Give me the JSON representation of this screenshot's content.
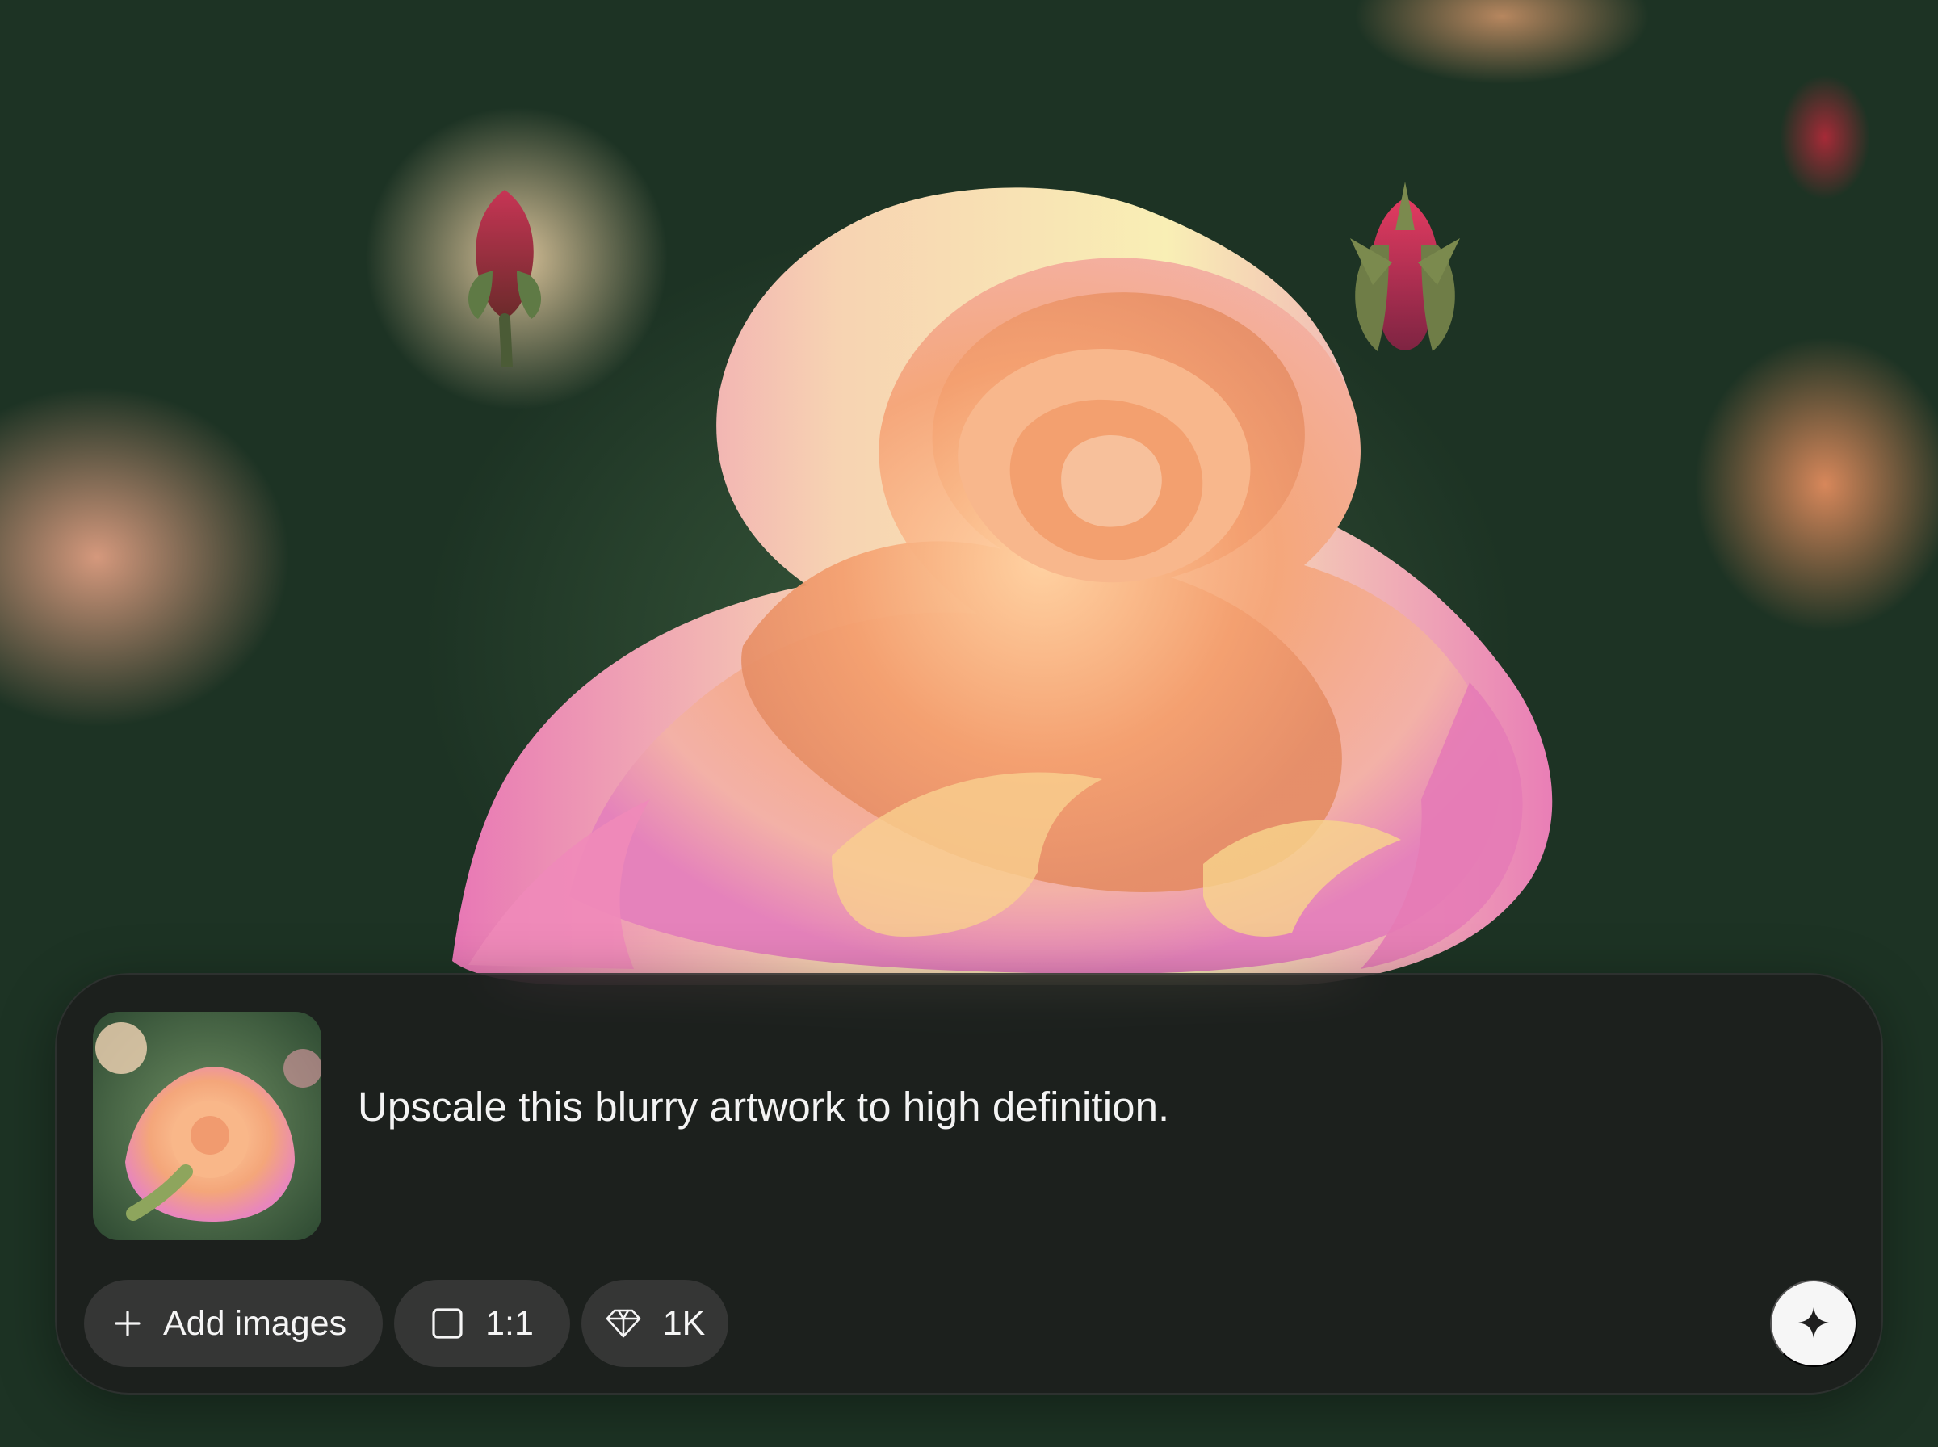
{
  "background": {
    "subject": "rose-image",
    "colors": {
      "petal_peach": "#f4a77b",
      "petal_pink": "#e587b8",
      "leaf_dark": "#1d3324",
      "leaf_mid": "#3a5a3c"
    }
  },
  "composer": {
    "thumbnail": {
      "icon": "rose-thumbnail"
    },
    "prompt_text": "Upscale this blurry artwork to high definition.",
    "toolbar": {
      "add_images": {
        "icon": "plus-icon",
        "label": "Add images"
      },
      "aspect_ratio": {
        "icon": "square-icon",
        "label": "1:1"
      },
      "resolution": {
        "icon": "diamond-icon",
        "label": "1K"
      }
    },
    "send_button": {
      "icon": "sparkle-icon"
    },
    "colors": {
      "panel_bg": "#1c1c1c",
      "chip_bg": "#3c3c3c",
      "text": "#f3f3f3",
      "send_bg": "#f6f6f6"
    }
  }
}
